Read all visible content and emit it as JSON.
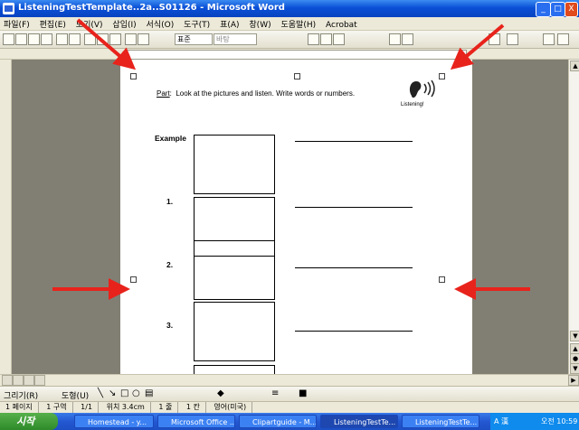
{
  "window": {
    "title": "ListeningTestTemplate..2a..S01126 - Microsoft Word",
    "minimize": "_",
    "maximize": "□",
    "close": "X"
  },
  "menu": [
    "파일(F)",
    "편집(E)",
    "보기(V)",
    "삽입(I)",
    "서식(O)",
    "도구(T)",
    "표(A)",
    "창(W)",
    "도움말(H)",
    "Acrobat"
  ],
  "toolbar": {
    "zoom_value": "",
    "style_value": "표준",
    "font_value": "바탕"
  },
  "document": {
    "part_label": "Part",
    "instruction": "Look at the pictures and listen.   Write words or numbers.",
    "listening_caption": "Listening!",
    "example_label": "Example",
    "items": [
      "1.",
      "2.",
      "3."
    ]
  },
  "drawbar": {
    "draw_label": "그리기(R)",
    "autoshape_label": "도형(U)"
  },
  "status": {
    "page": "1 페이지",
    "section": "1 구역",
    "page_of": "1/1",
    "position": "위치 3.4cm",
    "line": "1 줄",
    "column": "1 칸",
    "language": "영어(미국)"
  },
  "taskbar": {
    "start": "시작",
    "tasks": [
      "Homestead - y...",
      "Microsoft Office ...",
      "Clipartguide - M...",
      "ListeningTestTe...",
      "ListeningTestTe..."
    ],
    "clock": "오전 10:59"
  },
  "colors": {
    "arrow": "#e8231c",
    "titlebar": "#0a4fd6",
    "workspace": "#817f73"
  }
}
